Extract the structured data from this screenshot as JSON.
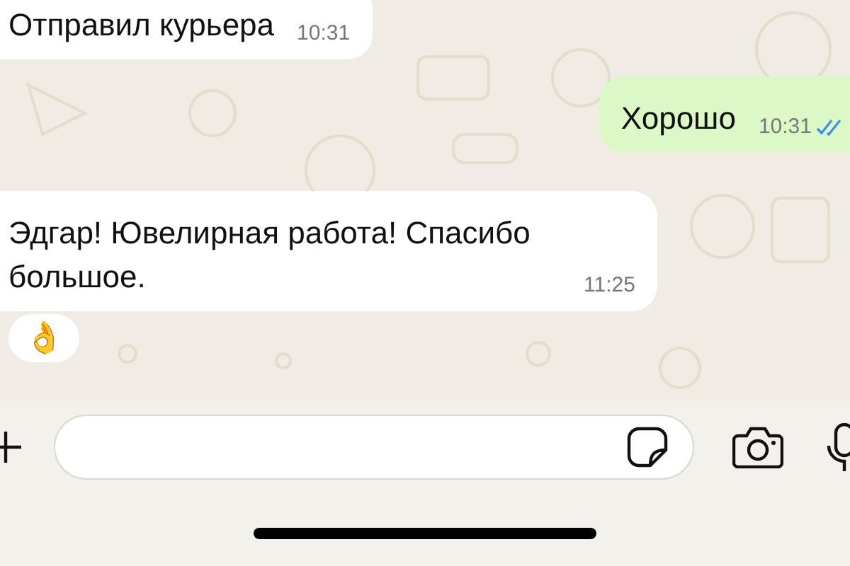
{
  "messages": [
    {
      "kind": "incoming",
      "text": "Отправил курьера",
      "time": "10:31"
    },
    {
      "kind": "outgoing",
      "text": "Хорошо",
      "time": "10:31",
      "read": true
    },
    {
      "kind": "incoming",
      "text": "Эдгар! Ювелирная работа! Спасибо большое.",
      "time": "11:25",
      "reaction": "👌"
    }
  ]
}
